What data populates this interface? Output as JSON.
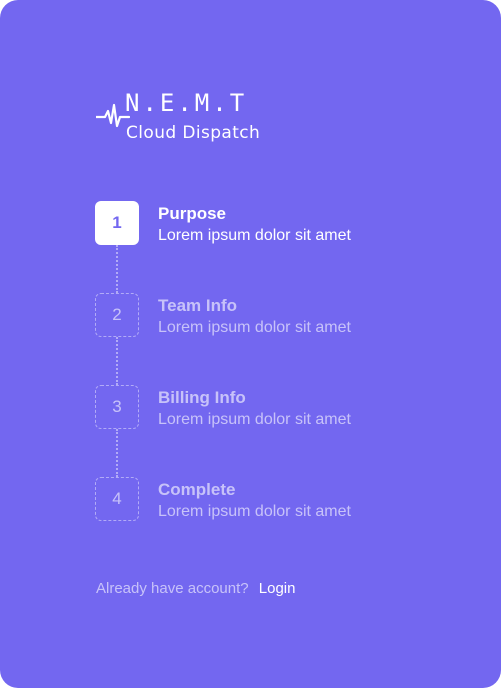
{
  "logo": {
    "brand": "N.E.M.T",
    "subtitle": "Cloud Dispatch"
  },
  "steps": [
    {
      "number": "1",
      "title": "Purpose",
      "description": "Lorem ipsum dolor sit amet",
      "state": "active"
    },
    {
      "number": "2",
      "title": "Team Info",
      "description": "Lorem ipsum dolor sit amet",
      "state": "inactive"
    },
    {
      "number": "3",
      "title": "Billing Info",
      "description": "Lorem ipsum dolor sit amet",
      "state": "inactive"
    },
    {
      "number": "4",
      "title": "Complete",
      "description": "Lorem ipsum dolor sit amet",
      "state": "inactive"
    }
  ],
  "footer": {
    "question": "Already have account?",
    "login_label": "Login"
  },
  "colors": {
    "panel": "#7367f0",
    "text": "#ffffff"
  }
}
